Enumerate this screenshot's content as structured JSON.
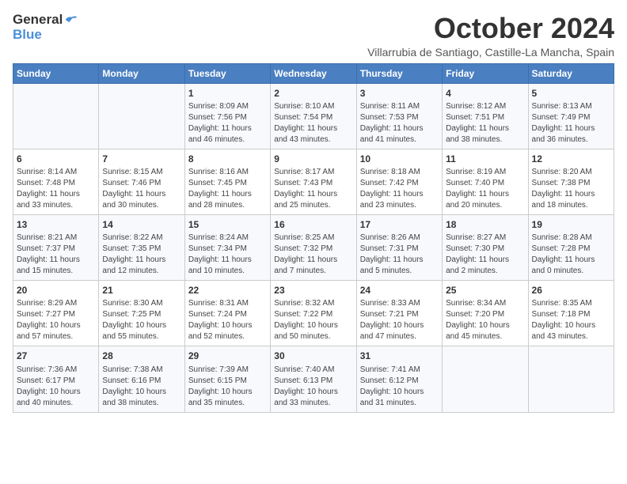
{
  "logo": {
    "general": "General",
    "blue": "Blue"
  },
  "title": "October 2024",
  "location": "Villarrubia de Santiago, Castille-La Mancha, Spain",
  "days_header": [
    "Sunday",
    "Monday",
    "Tuesday",
    "Wednesday",
    "Thursday",
    "Friday",
    "Saturday"
  ],
  "weeks": [
    [
      {
        "day": "",
        "content": ""
      },
      {
        "day": "",
        "content": ""
      },
      {
        "day": "1",
        "content": "Sunrise: 8:09 AM\nSunset: 7:56 PM\nDaylight: 11 hours\nand 46 minutes."
      },
      {
        "day": "2",
        "content": "Sunrise: 8:10 AM\nSunset: 7:54 PM\nDaylight: 11 hours\nand 43 minutes."
      },
      {
        "day": "3",
        "content": "Sunrise: 8:11 AM\nSunset: 7:53 PM\nDaylight: 11 hours\nand 41 minutes."
      },
      {
        "day": "4",
        "content": "Sunrise: 8:12 AM\nSunset: 7:51 PM\nDaylight: 11 hours\nand 38 minutes."
      },
      {
        "day": "5",
        "content": "Sunrise: 8:13 AM\nSunset: 7:49 PM\nDaylight: 11 hours\nand 36 minutes."
      }
    ],
    [
      {
        "day": "6",
        "content": "Sunrise: 8:14 AM\nSunset: 7:48 PM\nDaylight: 11 hours\nand 33 minutes."
      },
      {
        "day": "7",
        "content": "Sunrise: 8:15 AM\nSunset: 7:46 PM\nDaylight: 11 hours\nand 30 minutes."
      },
      {
        "day": "8",
        "content": "Sunrise: 8:16 AM\nSunset: 7:45 PM\nDaylight: 11 hours\nand 28 minutes."
      },
      {
        "day": "9",
        "content": "Sunrise: 8:17 AM\nSunset: 7:43 PM\nDaylight: 11 hours\nand 25 minutes."
      },
      {
        "day": "10",
        "content": "Sunrise: 8:18 AM\nSunset: 7:42 PM\nDaylight: 11 hours\nand 23 minutes."
      },
      {
        "day": "11",
        "content": "Sunrise: 8:19 AM\nSunset: 7:40 PM\nDaylight: 11 hours\nand 20 minutes."
      },
      {
        "day": "12",
        "content": "Sunrise: 8:20 AM\nSunset: 7:38 PM\nDaylight: 11 hours\nand 18 minutes."
      }
    ],
    [
      {
        "day": "13",
        "content": "Sunrise: 8:21 AM\nSunset: 7:37 PM\nDaylight: 11 hours\nand 15 minutes."
      },
      {
        "day": "14",
        "content": "Sunrise: 8:22 AM\nSunset: 7:35 PM\nDaylight: 11 hours\nand 12 minutes."
      },
      {
        "day": "15",
        "content": "Sunrise: 8:24 AM\nSunset: 7:34 PM\nDaylight: 11 hours\nand 10 minutes."
      },
      {
        "day": "16",
        "content": "Sunrise: 8:25 AM\nSunset: 7:32 PM\nDaylight: 11 hours\nand 7 minutes."
      },
      {
        "day": "17",
        "content": "Sunrise: 8:26 AM\nSunset: 7:31 PM\nDaylight: 11 hours\nand 5 minutes."
      },
      {
        "day": "18",
        "content": "Sunrise: 8:27 AM\nSunset: 7:30 PM\nDaylight: 11 hours\nand 2 minutes."
      },
      {
        "day": "19",
        "content": "Sunrise: 8:28 AM\nSunset: 7:28 PM\nDaylight: 11 hours\nand 0 minutes."
      }
    ],
    [
      {
        "day": "20",
        "content": "Sunrise: 8:29 AM\nSunset: 7:27 PM\nDaylight: 10 hours\nand 57 minutes."
      },
      {
        "day": "21",
        "content": "Sunrise: 8:30 AM\nSunset: 7:25 PM\nDaylight: 10 hours\nand 55 minutes."
      },
      {
        "day": "22",
        "content": "Sunrise: 8:31 AM\nSunset: 7:24 PM\nDaylight: 10 hours\nand 52 minutes."
      },
      {
        "day": "23",
        "content": "Sunrise: 8:32 AM\nSunset: 7:22 PM\nDaylight: 10 hours\nand 50 minutes."
      },
      {
        "day": "24",
        "content": "Sunrise: 8:33 AM\nSunset: 7:21 PM\nDaylight: 10 hours\nand 47 minutes."
      },
      {
        "day": "25",
        "content": "Sunrise: 8:34 AM\nSunset: 7:20 PM\nDaylight: 10 hours\nand 45 minutes."
      },
      {
        "day": "26",
        "content": "Sunrise: 8:35 AM\nSunset: 7:18 PM\nDaylight: 10 hours\nand 43 minutes."
      }
    ],
    [
      {
        "day": "27",
        "content": "Sunrise: 7:36 AM\nSunset: 6:17 PM\nDaylight: 10 hours\nand 40 minutes."
      },
      {
        "day": "28",
        "content": "Sunrise: 7:38 AM\nSunset: 6:16 PM\nDaylight: 10 hours\nand 38 minutes."
      },
      {
        "day": "29",
        "content": "Sunrise: 7:39 AM\nSunset: 6:15 PM\nDaylight: 10 hours\nand 35 minutes."
      },
      {
        "day": "30",
        "content": "Sunrise: 7:40 AM\nSunset: 6:13 PM\nDaylight: 10 hours\nand 33 minutes."
      },
      {
        "day": "31",
        "content": "Sunrise: 7:41 AM\nSunset: 6:12 PM\nDaylight: 10 hours\nand 31 minutes."
      },
      {
        "day": "",
        "content": ""
      },
      {
        "day": "",
        "content": ""
      }
    ]
  ]
}
